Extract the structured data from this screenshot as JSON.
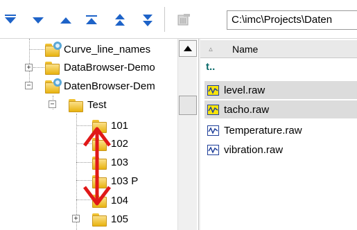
{
  "toolbar": {
    "buttons": [
      {
        "icon": "move-bottom-icon",
        "glyph": "▼"
      },
      {
        "icon": "move-down-icon",
        "glyph": "▼"
      },
      {
        "icon": "move-up-icon",
        "glyph": "▲"
      },
      {
        "icon": "move-top-icon",
        "glyph": "▲"
      },
      {
        "icon": "page-up-icon",
        "glyph": "⇑"
      },
      {
        "icon": "page-down-icon",
        "glyph": "⇓"
      }
    ],
    "delete_icon": "delete-icon",
    "path": "C:\\imc\\Projects\\Daten"
  },
  "tree": {
    "nodes": [
      {
        "label": "Curve_line_names",
        "icon": "search-folder-icon"
      },
      {
        "label": "DataBrowser-Demo",
        "icon": "folder-icon",
        "expander": "+"
      },
      {
        "label": "DatenBrowser-Dem",
        "icon": "search-folder-icon",
        "expander": "−"
      },
      {
        "label": "Test",
        "icon": "folder-icon",
        "expander": "−"
      },
      {
        "label": "101",
        "icon": "folder-icon"
      },
      {
        "label": "102",
        "icon": "folder-icon"
      },
      {
        "label": "103",
        "icon": "folder-icon"
      },
      {
        "label": "103 P",
        "icon": "folder-icon"
      },
      {
        "label": "104",
        "icon": "folder-icon"
      },
      {
        "label": "105",
        "icon": "folder-icon",
        "expander": "+"
      }
    ]
  },
  "files": {
    "header": "Name",
    "up_label": "t..",
    "items": [
      {
        "label": "level.raw",
        "selected": true
      },
      {
        "label": "tacho.raw",
        "selected": true
      },
      {
        "label": "Temperature.raw",
        "selected": false
      },
      {
        "label": "vibration.raw",
        "selected": false
      }
    ]
  },
  "colors": {
    "toolbar_arrow": "#1e63c8",
    "drag_arrow": "#e01818",
    "selection": "#dcdcdc",
    "wave_highlight": "#f8e40c"
  }
}
